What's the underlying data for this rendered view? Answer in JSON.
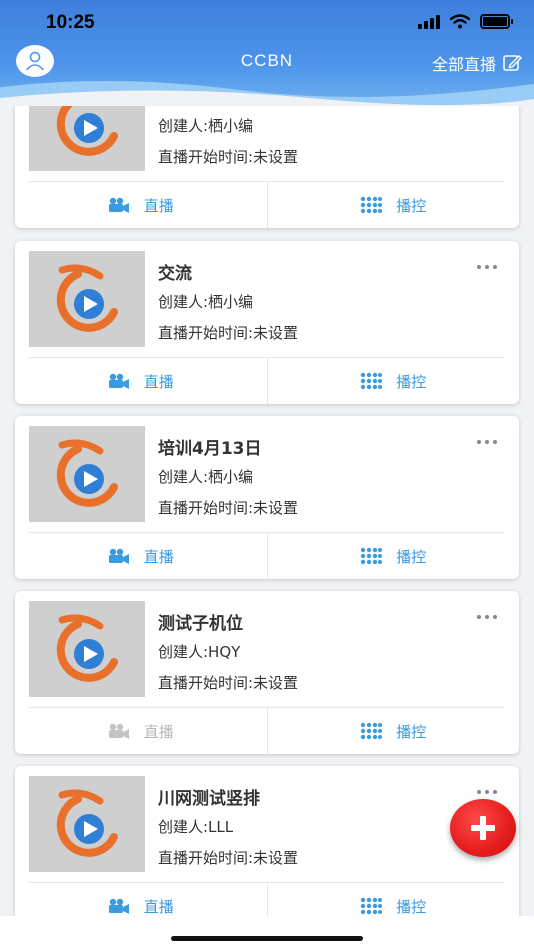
{
  "status_bar": {
    "time": "10:25"
  },
  "header": {
    "title": "CCBN",
    "all_live_label": "全部直播"
  },
  "cards": [
    {
      "title": "",
      "creator": "创建人:栖小编",
      "start": "直播开始时间:未设置",
      "live_label": "直播",
      "control_label": "播控",
      "live_enabled": true
    },
    {
      "title": "交流",
      "creator": "创建人:栖小编",
      "start": "直播开始时间:未设置",
      "live_label": "直播",
      "control_label": "播控",
      "live_enabled": true
    },
    {
      "title": "培训4月13日",
      "creator": "创建人:栖小编",
      "start": "直播开始时间:未设置",
      "live_label": "直播",
      "control_label": "播控",
      "live_enabled": true
    },
    {
      "title": "测试子机位",
      "creator": "创建人:HQY",
      "start": "直播开始时间:未设置",
      "live_label": "直播",
      "control_label": "播控",
      "live_enabled": false
    },
    {
      "title": "川网测试竖排",
      "creator": "创建人:LLL",
      "start": "直播开始时间:未设置",
      "live_label": "直播",
      "control_label": "播控",
      "live_enabled": true
    }
  ],
  "colors": {
    "accent": "#3a9be0",
    "header": "#4d94ea",
    "fab": "#e51c1c",
    "disabled": "#b8b8b8"
  },
  "icons": {
    "avatar": "user-icon",
    "edit": "edit-icon",
    "live": "video-camera-icon",
    "control": "grid-dots-icon",
    "more": "more-dots-icon",
    "fab": "plus-icon"
  }
}
